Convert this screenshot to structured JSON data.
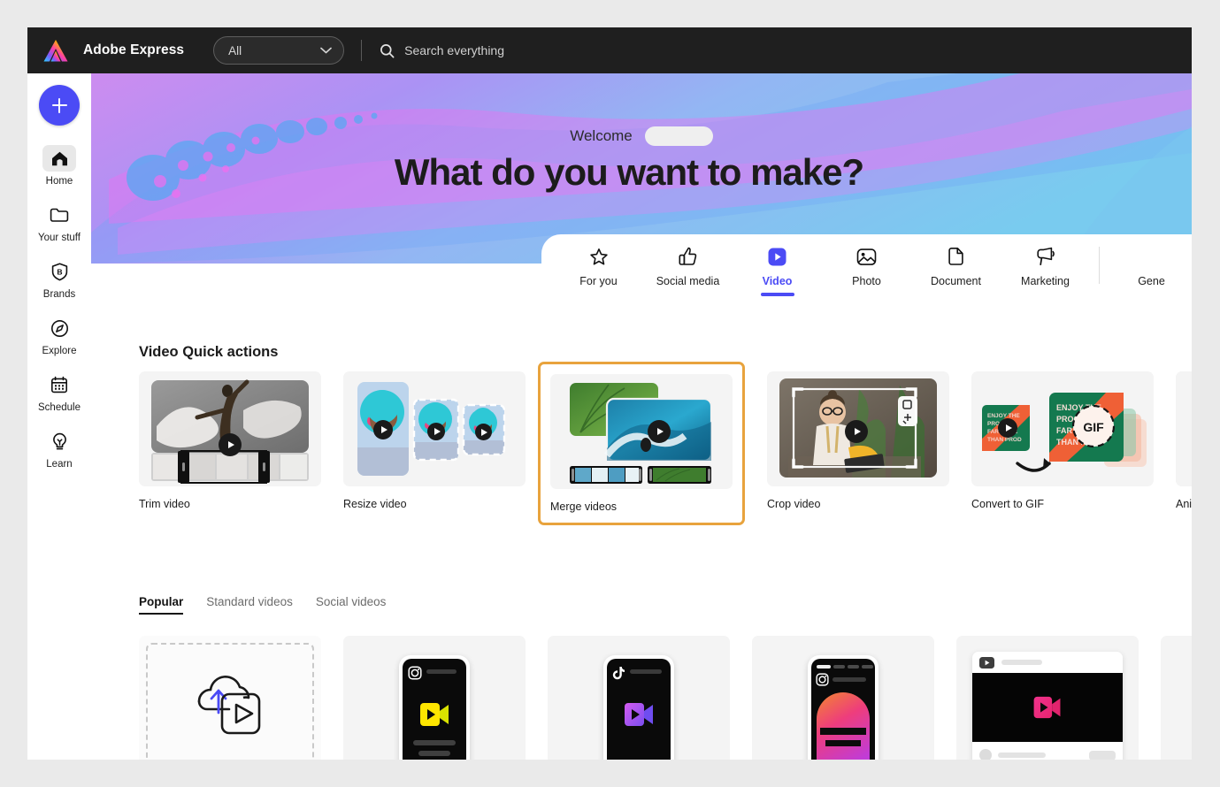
{
  "topbar": {
    "brand": "Adobe Express",
    "brand_logo_icon": "adobe-express-logo",
    "scope_value": "All",
    "scope_chevron_icon": "chevron-down-icon",
    "search_icon": "search-icon",
    "search_placeholder": "Search everything"
  },
  "sidebar": {
    "create_button_label": "+",
    "create_button_icon": "plus-icon",
    "items": [
      {
        "label": "Home",
        "icon": "home-icon",
        "active": true
      },
      {
        "label": "Your stuff",
        "icon": "folder-icon",
        "active": false
      },
      {
        "label": "Brands",
        "icon": "brand-icon",
        "active": false
      },
      {
        "label": "Explore",
        "icon": "compass-icon",
        "active": false
      },
      {
        "label": "Schedule",
        "icon": "calendar-icon",
        "active": false
      },
      {
        "label": "Learn",
        "icon": "bulb-icon",
        "active": false
      }
    ]
  },
  "hero": {
    "welcome_text": "Welcome",
    "user_name_placeholder": "",
    "headline": "What do you want to make?"
  },
  "category_tabs": {
    "items": [
      {
        "label": "For you",
        "icon": "star-icon",
        "active": false
      },
      {
        "label": "Social media",
        "icon": "thumbs-up-icon",
        "active": false
      },
      {
        "label": "Video",
        "icon": "video-icon",
        "active": true
      },
      {
        "label": "Photo",
        "icon": "image-icon",
        "active": false
      },
      {
        "label": "Document",
        "icon": "document-icon",
        "active": false
      },
      {
        "label": "Marketing",
        "icon": "megaphone-icon",
        "active": false
      },
      {
        "label": "Gene",
        "icon": "sparkle-icon",
        "active": false
      }
    ]
  },
  "quick_actions": {
    "title": "Video Quick actions",
    "cards": [
      {
        "label": "Trim video",
        "selected": false
      },
      {
        "label": "Resize video",
        "selected": false
      },
      {
        "label": "Merge videos",
        "selected": true
      },
      {
        "label": "Crop video",
        "selected": false
      },
      {
        "label": "Convert to GIF",
        "selected": false
      },
      {
        "label": "Animate fro",
        "selected": false
      }
    ],
    "highlight_color": "#e8a33d"
  },
  "template_tabs": {
    "items": [
      {
        "label": "Popular",
        "active": true
      },
      {
        "label": "Standard videos",
        "active": false
      },
      {
        "label": "Social videos",
        "active": false
      }
    ]
  },
  "templates": {
    "cards": [
      {
        "kind": "upload",
        "icon": "cloud-upload-video-icon"
      },
      {
        "kind": "instagram",
        "icon": "instagram-icon"
      },
      {
        "kind": "tiktok",
        "icon": "tiktok-icon"
      },
      {
        "kind": "instagram-gradient",
        "icon": "instagram-icon"
      },
      {
        "kind": "youtube",
        "icon": "youtube-icon"
      },
      {
        "kind": "phone-dark",
        "icon": "phone-icon"
      }
    ]
  },
  "colors": {
    "accent": "#4b4bf5",
    "topbar_bg": "#1f1f1f",
    "highlight": "#e8a33d",
    "page_bg": "#eaeaea"
  }
}
